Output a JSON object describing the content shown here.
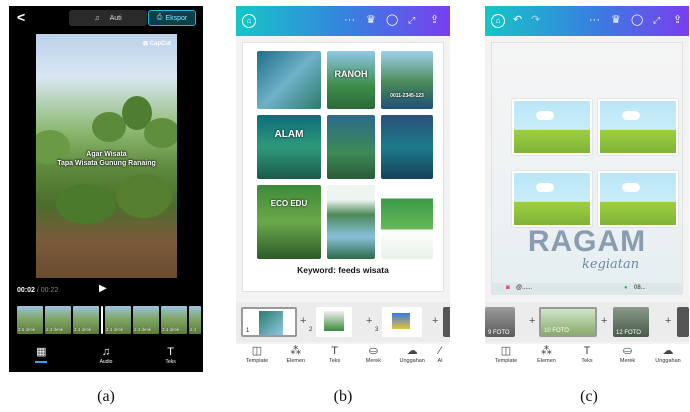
{
  "captions": [
    "(a)",
    "(b)",
    "(c)"
  ],
  "panel_a": {
    "back_icon": "chevron-left-icon",
    "resolution_label": "Auti",
    "export_label": "Ekspor",
    "brand": "⊠ CapCut",
    "subtitle_line1": "Agar Wisata",
    "subtitle_line2": "Tapa Wisata Gunung Ranaing",
    "time_current": "00:02",
    "time_total": "/ 00:22",
    "clip_labels": [
      "3.6 detik",
      "2.4 detik",
      "2.4 detik",
      "2.4 detik",
      "2.4 detik",
      "2.4 detik",
      "2.4"
    ],
    "nav": [
      {
        "icon": "film-icon",
        "label": ""
      },
      {
        "icon": "music-note-icon",
        "label": "Audio"
      },
      {
        "icon": "text-icon",
        "label": "Teks"
      }
    ]
  },
  "panel_b": {
    "tiles": [
      "RANOH",
      "ALAM",
      "ECO EDU",
      "0011-2345-123"
    ],
    "keyword": "Keyword: feeds wisata",
    "pages": [
      "1",
      "2",
      "3"
    ],
    "nav": [
      "Template",
      "Elemen",
      "Teks",
      "Merek",
      "Unggahan",
      "Al"
    ]
  },
  "panel_c": {
    "title": "RAGAM",
    "subtitle": "kegiatan",
    "footer_left": "@......",
    "footer_right": "08...",
    "page_labels": [
      "9 FOTO",
      "10 FOTO",
      "12 FOTO"
    ],
    "nav": [
      "Template",
      "Elemen",
      "Teks",
      "Merek",
      "Unggahan"
    ]
  },
  "colors": {
    "accent_capcut": "#1ab8d9",
    "canva_gradient_start": "#15c6c8",
    "canva_gradient_end": "#7a3ef0"
  }
}
